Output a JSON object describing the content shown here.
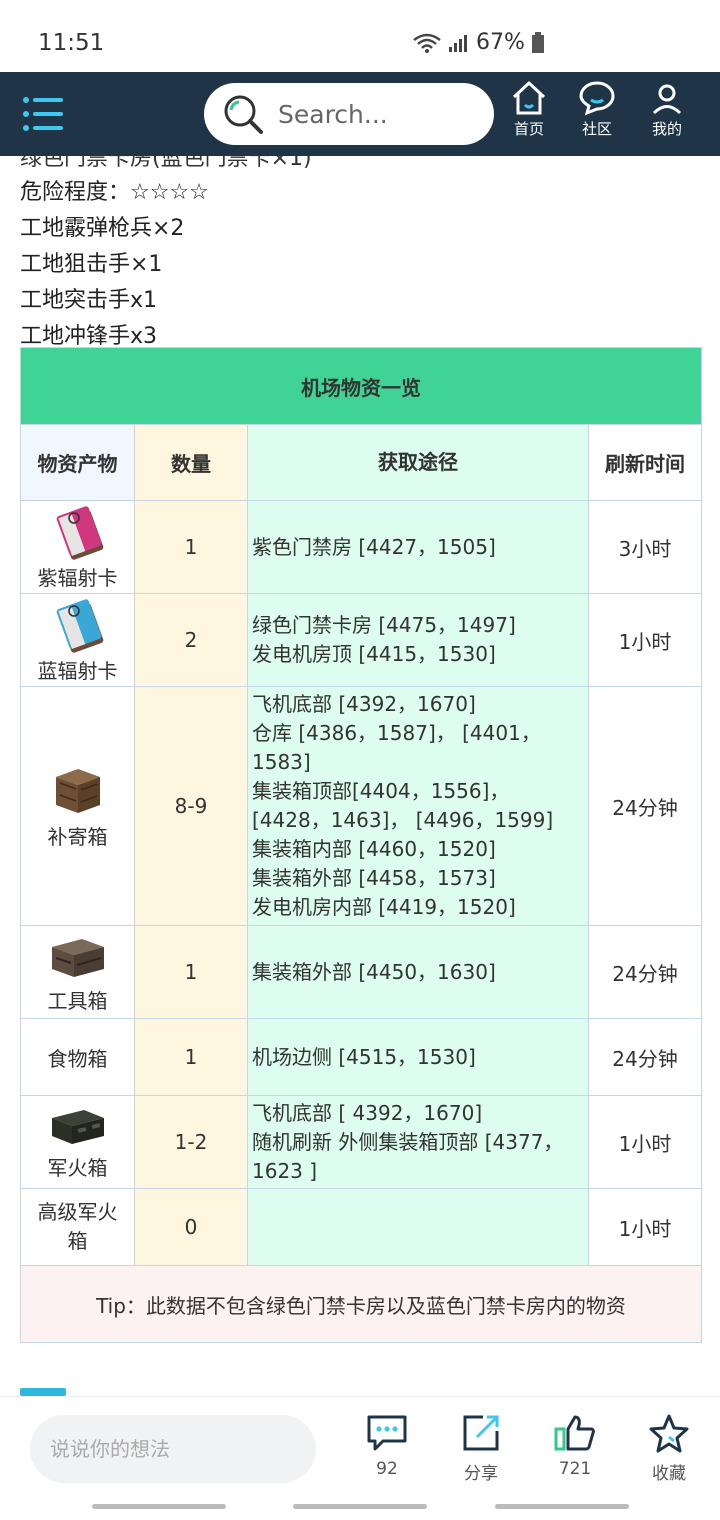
{
  "status": {
    "time": "11:51",
    "battery": "67%"
  },
  "nav": {
    "search_placeholder": "Search...",
    "tabs": [
      {
        "label": "首页"
      },
      {
        "label": "社区"
      },
      {
        "label": "我的"
      }
    ]
  },
  "content": {
    "clipped_line": "绿色门禁卡房(蓝色门禁卡×1)",
    "lines": [
      "危险程度：☆☆☆☆",
      "工地霰弹枪兵×2",
      "工地狙击手×1",
      "工地突击手x1",
      "工地冲锋手x3"
    ]
  },
  "table": {
    "title": "机场物资一览",
    "headers": [
      "物资产物",
      "数量",
      "获取途径",
      "刷新时间"
    ],
    "rows": [
      {
        "item": "紫辐射卡",
        "icon": "purple-radiation-card-icon",
        "qty": "1",
        "source": [
          "紫色门禁房 [4427，1505]"
        ],
        "refresh": "3小时"
      },
      {
        "item": "蓝辐射卡",
        "icon": "blue-radiation-card-icon",
        "qty": "2",
        "source": [
          "绿色门禁卡房 [4475，1497]",
          "发电机房顶 [4415，1530]"
        ],
        "refresh": "1小时"
      },
      {
        "item": "补寄箱",
        "icon": "supply-crate-icon",
        "qty": "8-9",
        "source": [
          "飞机底部 [4392，1670]",
          "仓库 [4386，1587]， [4401，",
          "1583]",
          "集装箱顶部[4404，1556]，",
          "[4428，1463]， [4496，1599]",
          "集装箱内部 [4460，1520]",
          "集装箱外部 [4458，1573]",
          "发电机房内部 [4419，1520]"
        ],
        "refresh": "24分钟"
      },
      {
        "item": "工具箱",
        "icon": "toolbox-icon",
        "qty": "1",
        "source": [
          "集装箱外部 [4450，1630]"
        ],
        "refresh": "24分钟"
      },
      {
        "item": "食物箱",
        "icon": "",
        "qty": "1",
        "source": [
          "机场边侧 [4515，1530]"
        ],
        "refresh": "24分钟"
      },
      {
        "item": "军火箱",
        "icon": "ammo-crate-icon",
        "qty": "1-2",
        "source": [
          "飞机底部 [ 4392，1670]",
          "随机刷新 外侧集装箱顶部 [4377，",
          "1623 ]"
        ],
        "refresh": "1小时"
      },
      {
        "item": "高级军火箱",
        "icon": "",
        "qty": "0",
        "source": [],
        "refresh": "1小时"
      }
    ],
    "tip": "Tip：此数据不包含绿色门禁卡房以及蓝色门禁卡房内的物资"
  },
  "bottom": {
    "comment_placeholder": "说说你的想法",
    "comments": "92",
    "share": "分享",
    "likes": "721",
    "favorite": "收藏"
  },
  "colors": {
    "nav_bg": "#1f3547",
    "title_green": "#3fd495",
    "accent": "#2fb7e0"
  }
}
